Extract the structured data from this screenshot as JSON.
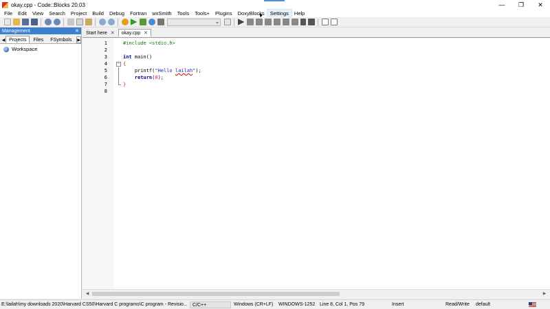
{
  "window": {
    "title": "okay.cpp - Code::Blocks 20.03",
    "controls": [
      "minimize",
      "maximize",
      "close"
    ]
  },
  "menu": [
    "File",
    "Edit",
    "View",
    "Search",
    "Project",
    "Build",
    "Debug",
    "Fortran",
    "wxSmith",
    "Tools",
    "Tools+",
    "Plugins",
    "DoxyBlocks",
    "Settings",
    "Help"
  ],
  "management": {
    "title": "Management",
    "tabs": [
      "Projects",
      "Files",
      "FSymbols"
    ],
    "active_tab": "Projects",
    "tree_root": "Workspace"
  },
  "editor_tabs": [
    {
      "label": "Start here",
      "active": false
    },
    {
      "label": "okay.cpp",
      "active": true
    }
  ],
  "code": {
    "line_numbers": [
      "1",
      "2",
      "3",
      "4",
      "5",
      "6",
      "7",
      "8"
    ],
    "line1": "#include <stdio.h>",
    "line3_kw": "int",
    "line3_rest": " main()",
    "line4": "{",
    "line5_fn": "    printf(",
    "line5_str1": "\"Hello ",
    "line5_name": "lailah",
    "line5_str2": "\"",
    "line5_end": ");",
    "line6_kw": "    return",
    "line6_open": "(",
    "line6_num": "0",
    "line6_close": ");",
    "line7": "}"
  },
  "status": {
    "path": "E:\\lailah\\my downloads 2020\\Harvard CS50\\Harvard C programs\\C program - Revisio...",
    "language": "C/C++",
    "line_endings": "Windows (CR+LF)",
    "encoding": "WINDOWS-1252",
    "position": "Line 8, Col 1, Pos 79",
    "mode": "Insert",
    "access": "Read/Write",
    "profile": "default"
  },
  "colors": {
    "management_header": "#3d7fd1",
    "preprocessor": "#0a7f0a",
    "keyword": "#00008b",
    "number": "#e0006f",
    "brace": "#dd0000"
  }
}
